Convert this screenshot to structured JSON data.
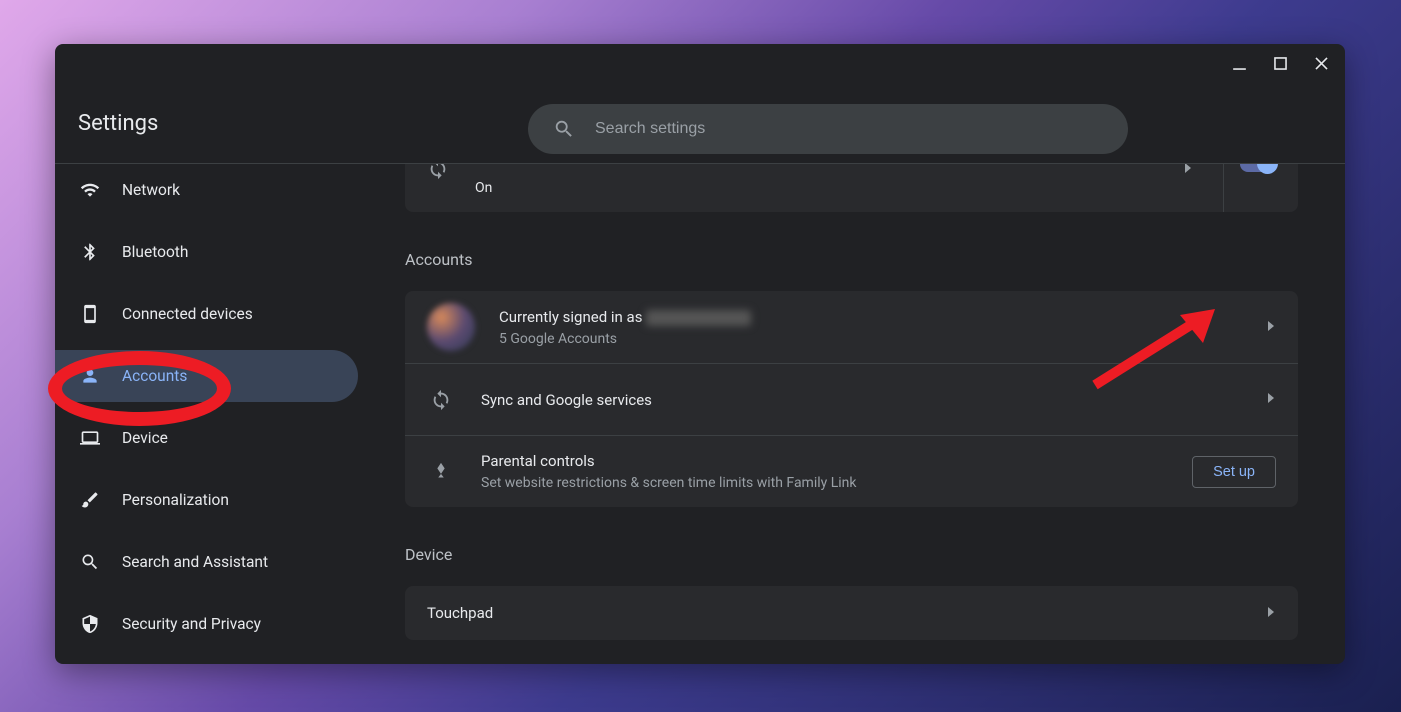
{
  "window": {
    "title": "Settings"
  },
  "search": {
    "placeholder": "Search settings"
  },
  "sidebar": {
    "items": [
      {
        "label": "Network"
      },
      {
        "label": "Bluetooth"
      },
      {
        "label": "Connected devices"
      },
      {
        "label": "Accounts"
      },
      {
        "label": "Device"
      },
      {
        "label": "Personalization"
      },
      {
        "label": "Search and Assistant"
      },
      {
        "label": "Security and Privacy"
      }
    ]
  },
  "partial": {
    "status": "On"
  },
  "sections": {
    "accounts": {
      "title": "Accounts",
      "signed_in": {
        "prefix": "Currently signed in as",
        "sub": "5 Google Accounts"
      },
      "sync": {
        "label": "Sync and Google services"
      },
      "parental": {
        "title": "Parental controls",
        "sub": "Set website restrictions & screen time limits with Family Link",
        "button": "Set up"
      }
    },
    "device": {
      "title": "Device",
      "touchpad": {
        "label": "Touchpad"
      }
    }
  }
}
